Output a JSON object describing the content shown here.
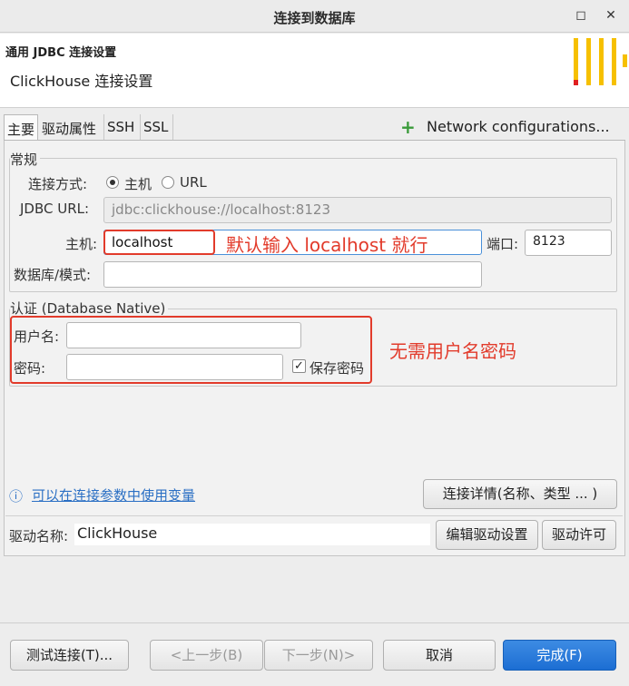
{
  "window": {
    "title": "连接到数据库",
    "maximize_glyph": "◻",
    "close_glyph": "✕"
  },
  "header": {
    "subtitle": "通用 JDBC 连接设置",
    "title": "ClickHouse 连接设置",
    "logo_color": "#f6c000",
    "logo_accent": "#e02020"
  },
  "tabs": [
    {
      "label": "主要",
      "active": true
    },
    {
      "label": "驱动属性",
      "active": false
    },
    {
      "label": "SSH",
      "active": false
    },
    {
      "label": "SSL",
      "active": false
    }
  ],
  "network": {
    "plus": "+",
    "label": "Network configurations..."
  },
  "general": {
    "group_label": "常规",
    "connect_by_label": "连接方式:",
    "radio_host": "主机",
    "radio_url": "URL",
    "jdbc_label": "JDBC URL:",
    "jdbc_value": "jdbc:clickhouse://localhost:8123",
    "host_label": "主机:",
    "host_value": "localhost",
    "port_label": "端口:",
    "port_value": "8123",
    "db_label": "数据库/模式:",
    "db_value": ""
  },
  "auth": {
    "group_label": "认证 (Database Native)",
    "user_label": "用户名:",
    "user_value": "",
    "password_label": "密码:",
    "password_value": "",
    "save_password_label": "保存密码",
    "save_password_checked": true
  },
  "annotations": {
    "host_note": "默认输入 localhost 就行",
    "auth_note": "无需用户名密码",
    "color": "#e23b2b"
  },
  "variables_link": {
    "icon": "ⓘ",
    "text": "可以在连接参数中使用变量"
  },
  "details_button": "连接详情(名称、类型 ... )",
  "driver": {
    "label": "驱动名称:",
    "value": "ClickHouse",
    "edit_button": "编辑驱动设置",
    "license_button": "驱动许可"
  },
  "footer": {
    "test_button": "测试连接(T)...",
    "back_button": "<上一步(B)",
    "next_button": "下一步(N)>",
    "cancel_button": "取消",
    "finish_button": "完成(F)"
  }
}
